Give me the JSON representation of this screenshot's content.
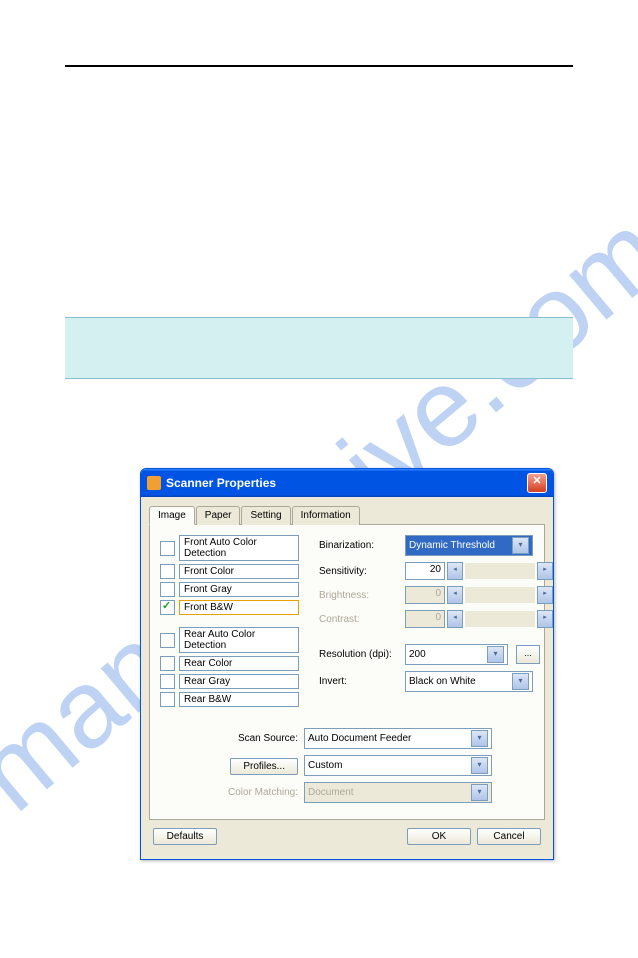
{
  "watermark": "manualshive.com",
  "dialog": {
    "title": "Scanner Properties",
    "tabs": [
      "Image",
      "Paper",
      "Setting",
      "Information"
    ],
    "checkboxes": {
      "front_auto": "Front Auto Color Detection",
      "front_color": "Front Color",
      "front_gray": "Front Gray",
      "front_bw": "Front B&W",
      "rear_auto": "Rear Auto Color Detection",
      "rear_color": "Rear Color",
      "rear_gray": "Rear Gray",
      "rear_bw": "Rear B&W"
    },
    "settings": {
      "binarization_label": "Binarization:",
      "binarization_value": "Dynamic Threshold",
      "sensitivity_label": "Sensitivity:",
      "sensitivity_value": "20",
      "brightness_label": "Brightness:",
      "brightness_value": "0",
      "contrast_label": "Contrast:",
      "contrast_value": "0",
      "resolution_label": "Resolution (dpi):",
      "resolution_value": "200",
      "invert_label": "Invert:",
      "invert_value": "Black on White",
      "browse": "..."
    },
    "lower": {
      "scan_source_label": "Scan Source:",
      "scan_source_value": "Auto Document Feeder",
      "profiles_btn": "Profiles...",
      "profiles_value": "Custom",
      "color_matching_label": "Color Matching:",
      "color_matching_value": "Document"
    },
    "footer": {
      "defaults": "Defaults",
      "ok": "OK",
      "cancel": "Cancel"
    }
  }
}
